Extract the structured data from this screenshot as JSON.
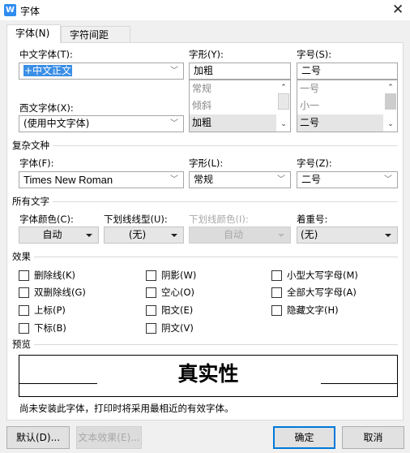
{
  "window": {
    "title": "字体",
    "app_icon": "wps-writer-icon",
    "close_icon": "close-icon"
  },
  "tabs": [
    {
      "label": "字体(N)",
      "active": true
    },
    {
      "label": "字符间距(R)",
      "active": false
    }
  ],
  "chinese_font": {
    "label": "中文字体(T):",
    "value": "+中文正文"
  },
  "western_font": {
    "label": "西文字体(X):",
    "value": "(使用中文字体)"
  },
  "style": {
    "label": "字形(Y):",
    "value": "加粗",
    "options": [
      "常规",
      "倾斜",
      "加粗"
    ],
    "selected": "加粗"
  },
  "size": {
    "label": "字号(S):",
    "value": "二号",
    "options": [
      "一号",
      "小一",
      "二号"
    ],
    "selected": "二号"
  },
  "complex": {
    "section": "复杂文种",
    "font_label": "字体(F):",
    "font_value": "Times New Roman",
    "style_label": "字形(L):",
    "style_value": "常规",
    "size_label": "字号(Z):",
    "size_value": "二号"
  },
  "all_text": {
    "section": "所有文字",
    "color_label": "字体颜色(C):",
    "color_value": "自动",
    "underline_label": "下划线线型(U):",
    "underline_value": "(无)",
    "underline_color_label": "下划线颜色(I):",
    "underline_color_value": "自动",
    "emphasis_label": "着重号:",
    "emphasis_value": "(无)"
  },
  "effects": {
    "section": "效果",
    "items": [
      {
        "label": "删除线(K)",
        "checked": false
      },
      {
        "label": "阴影(W)",
        "checked": false
      },
      {
        "label": "小型大写字母(M)",
        "checked": false
      },
      {
        "label": "双删除线(G)",
        "checked": false
      },
      {
        "label": "空心(O)",
        "checked": false
      },
      {
        "label": "全部大写字母(A)",
        "checked": false
      },
      {
        "label": "上标(P)",
        "checked": false
      },
      {
        "label": "阳文(E)",
        "checked": false
      },
      {
        "label": "隐藏文字(H)",
        "checked": false
      },
      {
        "label": "下标(B)",
        "checked": false
      },
      {
        "label": "阴文(V)",
        "checked": false
      }
    ]
  },
  "preview": {
    "section": "预览",
    "text": "真实性",
    "note": "尚未安装此字体，打印时将采用最相近的有效字体。"
  },
  "buttons": {
    "default": "默认(D)...",
    "text_effects": "文本效果(E)...",
    "ok": "确定",
    "cancel": "取消"
  },
  "colors": {
    "accent": "#3a8ee6",
    "ok_border": "#0078d7"
  }
}
